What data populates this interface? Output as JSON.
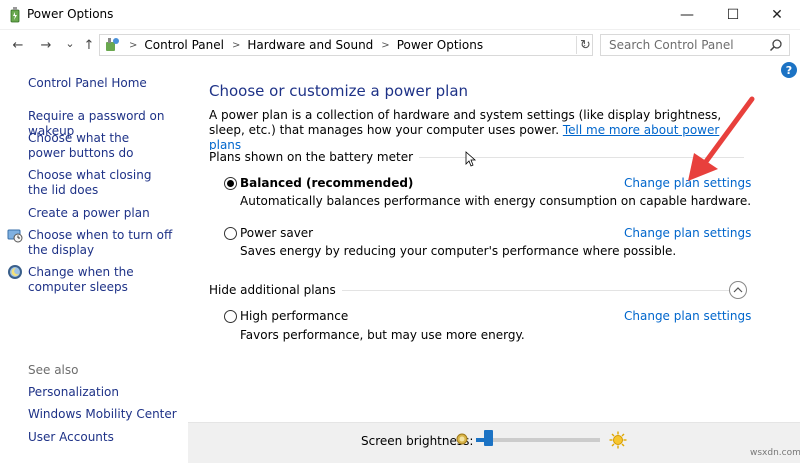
{
  "window": {
    "title": "Power Options",
    "minimize_glyph": "—",
    "maximize_glyph": "☐",
    "close_glyph": "✕"
  },
  "nav": {
    "back_glyph": "←",
    "forward_glyph": "→",
    "recent_glyph": "⌄",
    "up_glyph": "↑",
    "refresh_glyph": "↻",
    "breadcrumbs": [
      "Control Panel",
      "Hardware and Sound",
      "Power Options"
    ],
    "search_placeholder": "Search Control Panel"
  },
  "sidebar": {
    "home": "Control Panel Home",
    "links": [
      "Require a password on wakeup",
      "Choose what the power buttons do",
      "Choose what closing the lid does",
      "Create a power plan",
      "Choose when to turn off the display",
      "Change when the computer sleeps"
    ],
    "see_also_label": "See also",
    "see_also": [
      "Personalization",
      "Windows Mobility Center",
      "User Accounts"
    ]
  },
  "main": {
    "help_glyph": "?",
    "heading": "Choose or customize a power plan",
    "description": "A power plan is a collection of hardware and system settings (like display brightness, sleep, etc.) that manages how your computer uses power.",
    "learn_more": "Tell me more about power plans",
    "battery_group_label": "Plans shown on the battery meter",
    "additional_group_label": "Hide additional plans",
    "plans": [
      {
        "name": "Balanced (recommended)",
        "description": "Automatically balances performance with energy consumption on capable hardware.",
        "link": "Change plan settings",
        "selected": true
      },
      {
        "name": "Power saver",
        "description": "Saves energy by reducing your computer's performance where possible.",
        "link": "Change plan settings",
        "selected": false
      },
      {
        "name": "High performance",
        "description": "Favors performance, but may use more energy.",
        "link": "Change plan settings",
        "selected": false
      }
    ]
  },
  "brightness": {
    "label": "Screen brightness:",
    "level_percent": 7
  },
  "watermark": "wsxdn.com",
  "colors": {
    "link": "#1e3287",
    "hyperlink": "#0066cc",
    "accent": "#1c73c4",
    "annotation_arrow": "#e8403c"
  }
}
